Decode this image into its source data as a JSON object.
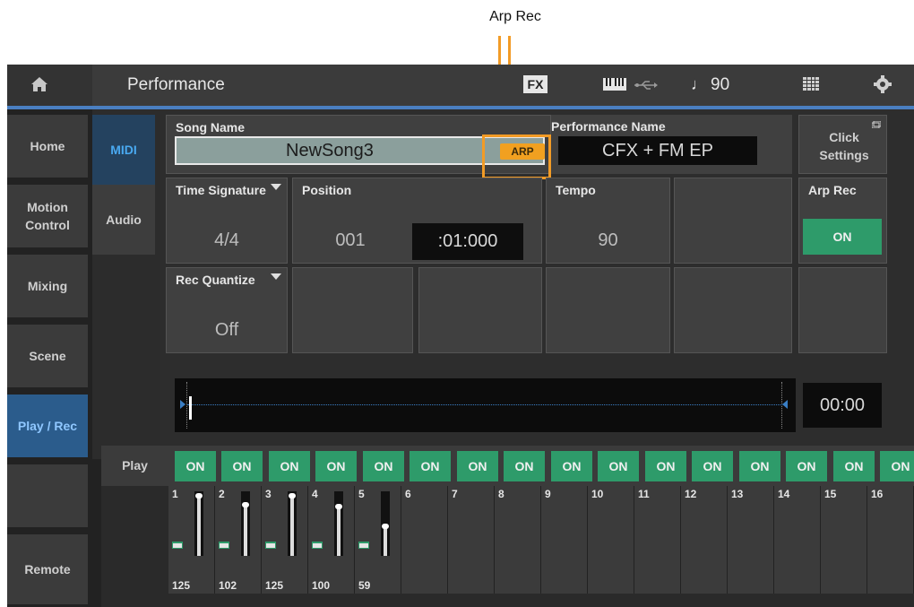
{
  "callout": {
    "label": "Arp Rec"
  },
  "topbar": {
    "title": "Performance",
    "fx_label": "FX",
    "tempo_note": "♩",
    "tempo": "90",
    "icons": [
      "home-icon",
      "keyboard-icon",
      "usb-icon",
      "grid-icon",
      "gear-icon"
    ]
  },
  "sidebar": {
    "items": [
      {
        "label": "Home"
      },
      {
        "label": "Motion Control"
      },
      {
        "label": "Mixing"
      },
      {
        "label": "Scene"
      },
      {
        "label": "Play / Rec",
        "active": true
      },
      {
        "label": ""
      },
      {
        "label": "Remote"
      }
    ]
  },
  "subtabs": {
    "midi": "MIDI",
    "audio": "Audio"
  },
  "song": {
    "label": "Song Name",
    "value": "NewSong3",
    "arp_badge": "ARP"
  },
  "performance": {
    "label": "Performance Name",
    "value": "CFX + FM EP"
  },
  "click_settings": {
    "label": "Click Settings"
  },
  "time_signature": {
    "label": "Time Signature",
    "value": "4/4"
  },
  "position": {
    "label": "Position",
    "measure": "001",
    "beat": ":01:000"
  },
  "tempo": {
    "label": "Tempo",
    "value": "90"
  },
  "arp_rec": {
    "label": "Arp Rec",
    "value": "ON"
  },
  "rec_quantize": {
    "label": "Rec Quantize",
    "value": "Off"
  },
  "time_display": "00:00",
  "play": {
    "label": "Play",
    "parts": [
      "ON",
      "ON",
      "ON",
      "ON",
      "ON",
      "ON",
      "ON",
      "ON",
      "ON",
      "ON",
      "ON",
      "ON",
      "ON",
      "ON",
      "ON",
      "ON"
    ]
  },
  "parts": [
    {
      "num": "1",
      "volume": "125"
    },
    {
      "num": "2",
      "volume": "102"
    },
    {
      "num": "3",
      "volume": "125"
    },
    {
      "num": "4",
      "volume": "100"
    },
    {
      "num": "5",
      "volume": "59"
    },
    {
      "num": "6",
      "volume": ""
    },
    {
      "num": "7",
      "volume": ""
    },
    {
      "num": "8",
      "volume": ""
    },
    {
      "num": "9",
      "volume": ""
    },
    {
      "num": "10",
      "volume": ""
    },
    {
      "num": "11",
      "volume": ""
    },
    {
      "num": "12",
      "volume": ""
    },
    {
      "num": "13",
      "volume": ""
    },
    {
      "num": "14",
      "volume": ""
    },
    {
      "num": "15",
      "volume": ""
    },
    {
      "num": "16",
      "volume": ""
    }
  ],
  "colors": {
    "accent_blue": "#4a7fc1",
    "on_green": "#2e9b6a",
    "arp_orange": "#f1a020",
    "callout_orange": "#f29b26"
  }
}
